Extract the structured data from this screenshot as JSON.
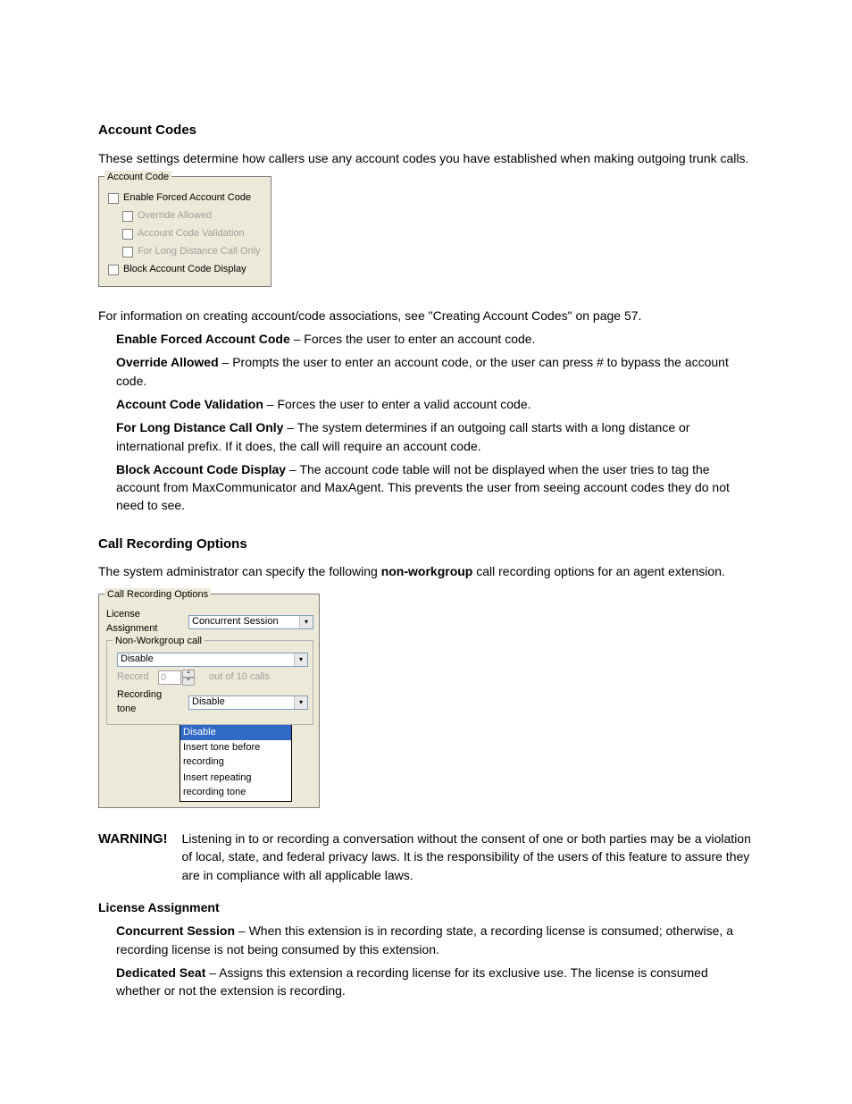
{
  "section1": {
    "heading": "Account Codes",
    "intro": "These settings determine how callers use any account codes you have established when making outgoing trunk calls.",
    "group_legend": "Account Code",
    "opts": {
      "enable": "Enable Forced Account Code",
      "override": "Override Allowed",
      "validation": "Account Code Validation",
      "longdist": "For Long Distance Call Only",
      "block": "Block Account Code Display"
    },
    "after": "For information on creating account/code associations, see \"Creating Account Codes\" on page 57.",
    "bullets": {
      "b1_label": "Enable Forced Account Code",
      "b1_text": " – Forces the user to enter an account code.",
      "b2_label": "Override Allowed",
      "b2_text": " – Prompts the user to enter an account code, or the user can press # to bypass the account code.",
      "b3_label": "Account Code Validation",
      "b3_text": " – Forces the user to enter a valid account code.",
      "b4_label": "For Long Distance Call Only",
      "b4_text": " – The system determines if an outgoing call starts with a long distance or international prefix. If it does, the call will require an account code.",
      "b5_label": "Block Account Code Display",
      "b5_text": " – The account code table will not be displayed when the user tries to tag the account from MaxCommunicator and MaxAgent. This prevents the user from seeing account codes they do not need to see."
    }
  },
  "section2": {
    "heading": "Call Recording Options",
    "intro_a": "The system administrator can specify the following ",
    "intro_b": "non-workgroup",
    "intro_c": " call recording options for an agent extension.",
    "group_legend": "Call Recording Options",
    "license_label": "License Assignment",
    "license_value": "Concurrent Session",
    "inner_legend": "Non-Workgroup call",
    "disable_value": "Disable",
    "record_label": "Record",
    "record_value": "0",
    "record_suffix": "out of 10 calls",
    "tone_label": "Recording tone",
    "tone_value": "Disable",
    "dd_opts": {
      "o1": "Disable",
      "o2": "Insert tone before recording",
      "o3": "Insert repeating recording tone"
    },
    "warning_label": "WARNING!",
    "warning_body": "Listening in to or recording a conversation without the consent of one or both parties may be a violation of local, state, and federal privacy laws. It is the responsibility of the users of this feature to assure they are in compliance with all applicable laws.",
    "license_head": "License Assignment",
    "lic1_label": "Concurrent Session",
    "lic1_text": " – When this extension is in recording state, a recording license is consumed; otherwise, a recording license is not being consumed by this extension.",
    "lic2_label": "Dedicated Seat",
    "lic2_text": " – Assigns this extension a recording license for its exclusive use. The license is consumed whether or not the extension is recording."
  }
}
